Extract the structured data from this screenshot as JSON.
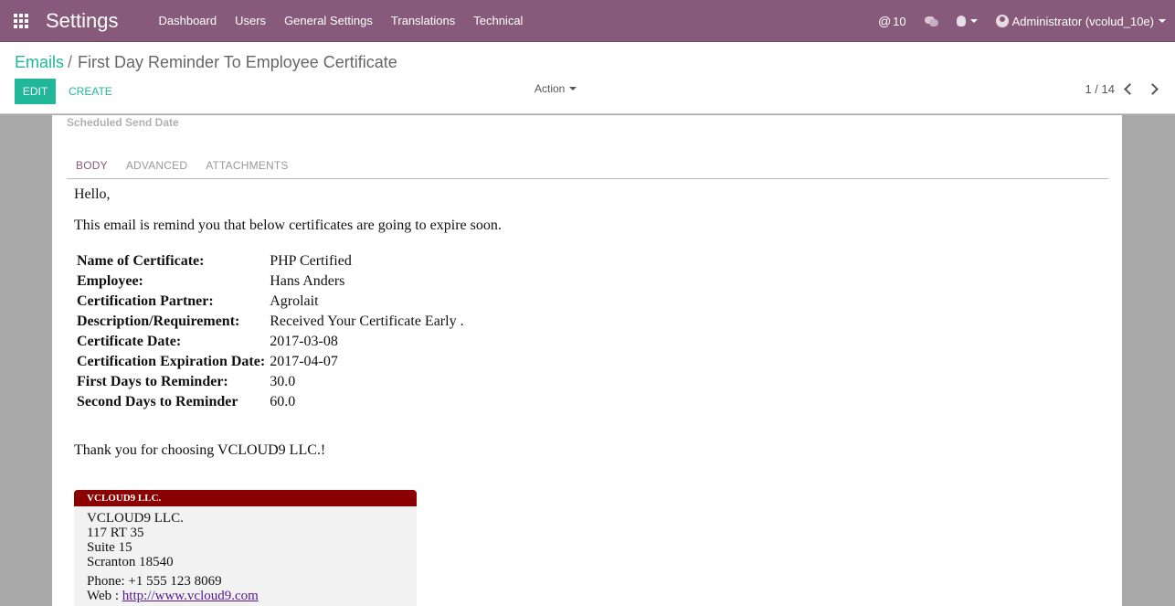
{
  "navbar": {
    "app_title": "Settings",
    "menu": [
      "Dashboard",
      "Users",
      "General Settings",
      "Translations",
      "Technical"
    ],
    "mentions_count": "10",
    "user_label": "Administrator (vcolud_10e)"
  },
  "control_panel": {
    "breadcrumb_parent": "Emails",
    "breadcrumb_separator": "/",
    "breadcrumb_current": "First Day Reminder To Employee Certificate",
    "edit_label": "EDIT",
    "create_label": "CREATE",
    "action_label": "Action",
    "pager": "1 / 14"
  },
  "form": {
    "scheduled_send_date_label": "Scheduled Send Date",
    "tabs": [
      "BODY",
      "ADVANCED",
      "ATTACHMENTS"
    ]
  },
  "email_body": {
    "greeting": "Hello,",
    "intro": "This email is remind you that below certificates are going to expire soon.",
    "rows": [
      {
        "label": "Name of Certificate:",
        "value": "PHP Certified"
      },
      {
        "label": "Employee:",
        "value": "Hans Anders"
      },
      {
        "label": "Certification Partner:",
        "value": "Agrolait"
      },
      {
        "label": "Description/Requirement:",
        "value": "Received Your Certificate Early ."
      },
      {
        "label": "Certificate Date:",
        "value": "2017-03-08"
      },
      {
        "label": "Certification Expiration Date:",
        "value": "2017-04-07"
      },
      {
        "label": "First Days to Reminder:",
        "value": "30.0"
      },
      {
        "label": "Second Days to Reminder",
        "value": "60.0"
      }
    ],
    "thanks": "Thank you for choosing VCLOUD9 LLC.!"
  },
  "company_card": {
    "header": "VCLOUD9 LLC.",
    "name": "VCLOUD9 LLC.",
    "street": "117 RT 35",
    "street2": "Suite 15",
    "city_zip": "Scranton 18540",
    "phone": "Phone:  +1 555 123 8069",
    "web_label": "Web : ",
    "web_url": "http://www.vcloud9.com"
  },
  "colors": {
    "navbar": "#875a7b",
    "accent": "#21b799",
    "card_header": "#8a0000"
  }
}
